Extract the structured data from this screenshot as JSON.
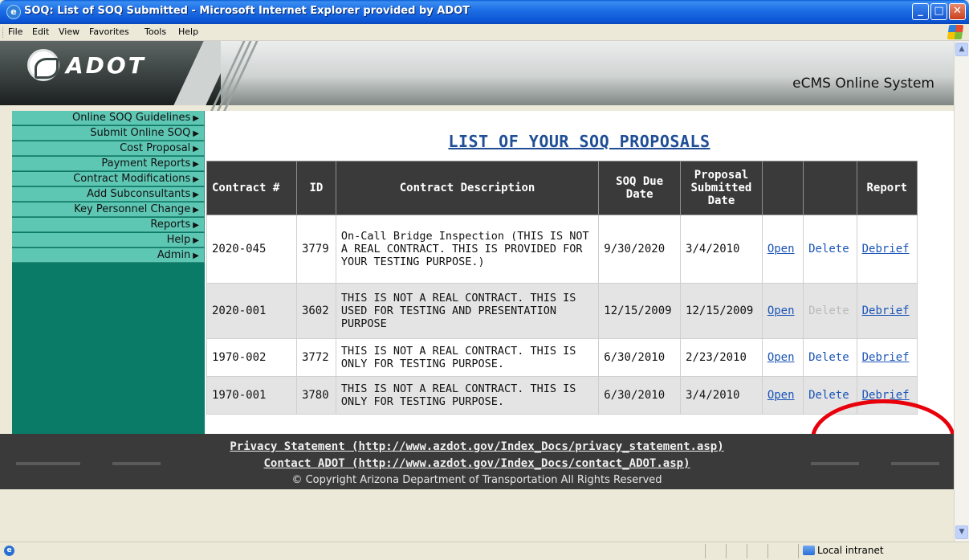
{
  "window": {
    "title": "SOQ: List of SOQ Submitted - Microsoft Internet Explorer provided by ADOT",
    "app_icon": "ie-icon",
    "buttons": [
      "minimize",
      "maximize",
      "close"
    ]
  },
  "menubar": {
    "items": [
      {
        "label": "File"
      },
      {
        "label": "Edit"
      },
      {
        "label": "View"
      },
      {
        "label": "Favorites"
      },
      {
        "label": "Tools"
      },
      {
        "label": "Help"
      }
    ]
  },
  "header": {
    "logo_text": "ADOT",
    "system_name": "eCMS Online System"
  },
  "sidebar": {
    "items": [
      {
        "label": "Online SOQ Guidelines"
      },
      {
        "label": "Submit Online SOQ"
      },
      {
        "label": "Cost Proposal"
      },
      {
        "label": "Payment Reports"
      },
      {
        "label": "Contract Modifications"
      },
      {
        "label": "Add Subconsultants"
      },
      {
        "label": "Key Personnel Change"
      },
      {
        "label": "Reports"
      },
      {
        "label": "Help"
      },
      {
        "label": "Admin"
      }
    ]
  },
  "main": {
    "title": "LIST OF YOUR SOQ PROPOSALS",
    "table": {
      "headers": [
        "Contract #",
        "ID",
        "Contract Description",
        "SOQ Due Date",
        "Proposal Submitted Date",
        "",
        "",
        "Report"
      ],
      "rows": [
        {
          "contract": "2020-045",
          "id": "3779",
          "description": "On-Call Bridge Inspection (THIS IS NOT A REAL CONTRACT. THIS IS PROVIDED FOR YOUR TESTING PURPOSE.)",
          "due_date": "9/30/2020",
          "submitted_date": "3/4/2010",
          "open": "Open",
          "delete": "Delete",
          "delete_enabled": true,
          "report": "Debrief"
        },
        {
          "contract": "2020-001",
          "id": "3602",
          "description": "THIS IS NOT A REAL CONTRACT. THIS IS USED FOR TESTING AND PRESENTATION PURPOSE",
          "due_date": "12/15/2009",
          "submitted_date": "12/15/2009",
          "open": "Open",
          "delete": "Delete",
          "delete_enabled": false,
          "report": "Debrief"
        },
        {
          "contract": "1970-002",
          "id": "3772",
          "description": "THIS IS NOT A REAL CONTRACT. THIS IS ONLY FOR TESTING PURPOSE.",
          "due_date": "6/30/2010",
          "submitted_date": "2/23/2010",
          "open": "Open",
          "delete": "Delete",
          "delete_enabled": true,
          "report": "Debrief"
        },
        {
          "contract": "1970-001",
          "id": "3780",
          "description": "THIS IS NOT A REAL CONTRACT. THIS IS ONLY FOR TESTING PURPOSE.",
          "due_date": "6/30/2010",
          "submitted_date": "3/4/2010",
          "open": "Open",
          "delete": "Delete",
          "delete_enabled": true,
          "report": "Debrief"
        }
      ]
    }
  },
  "footer": {
    "privacy": "Privacy Statement (http://www.azdot.gov/Index_Docs/privacy_statement.asp)",
    "contact": "Contact ADOT (http://www.azdot.gov/Index_Docs/contact_ADOT.asp)",
    "copyright": "© Copyright Arizona Department of Transportation All Rights Reserved"
  },
  "statusbar": {
    "zone": "Local intranet"
  },
  "colors": {
    "title_bar": "#0b55d4",
    "sidebar_bg": "#0a7b66",
    "sidebar_item": "#5ec7b4",
    "table_header": "#3a3a3a",
    "link": "#1b55b8",
    "highlight": "#e8000b"
  }
}
